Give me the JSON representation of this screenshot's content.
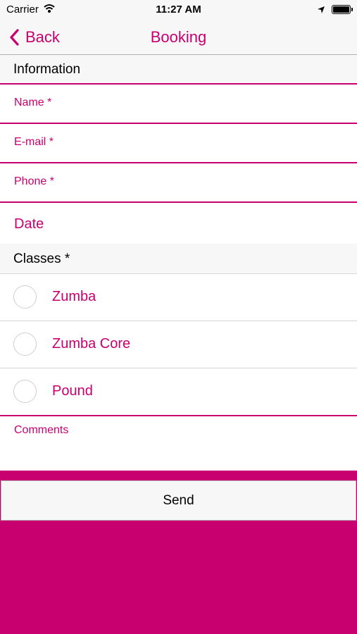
{
  "status_bar": {
    "carrier": "Carrier",
    "time": "11:27 AM"
  },
  "nav": {
    "back_label": "Back",
    "title": "Booking"
  },
  "sections": {
    "information": "Information",
    "classes": "Classes *"
  },
  "fields": {
    "name": "Name *",
    "email": "E-mail *",
    "phone": "Phone *",
    "date": "Date",
    "comments": "Comments"
  },
  "classes": [
    {
      "label": "Zumba"
    },
    {
      "label": "Zumba Core"
    },
    {
      "label": "Pound"
    }
  ],
  "send_label": "Send",
  "colors": {
    "accent": "#c8006f",
    "header_bg": "#f7f7f7"
  }
}
